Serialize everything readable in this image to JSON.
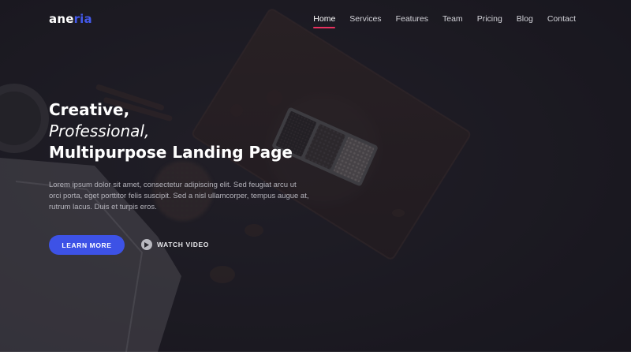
{
  "brand": {
    "logo_part1": "ane",
    "logo_part2": "ria",
    "accent_color": "#4359ea"
  },
  "nav": {
    "items": [
      {
        "label": "Home",
        "active": true
      },
      {
        "label": "Services",
        "active": false
      },
      {
        "label": "Features",
        "active": false
      },
      {
        "label": "Team",
        "active": false
      },
      {
        "label": "Pricing",
        "active": false
      },
      {
        "label": "Blog",
        "active": false
      },
      {
        "label": "Contact",
        "active": false
      }
    ],
    "active_indicator_color": "#e8315f"
  },
  "hero": {
    "headline_line1": "Creative,",
    "headline_line2": "Professional,",
    "headline_line3": "Multipurpose Landing Page",
    "description": "Lorem ipsum dolor sit amet, consectetur adipiscing elit. Sed feugiat arcu ut orci porta, eget porttitor felis suscipit. Sed a nisl ullamcorper, tempus augue at, rutrum lacus. Duis et turpis eros.",
    "primary_button": "LEARN MORE",
    "primary_button_color": "#3d52e6",
    "secondary_button": "WATCH VIDEO",
    "secondary_icon": "play-circle-icon"
  }
}
